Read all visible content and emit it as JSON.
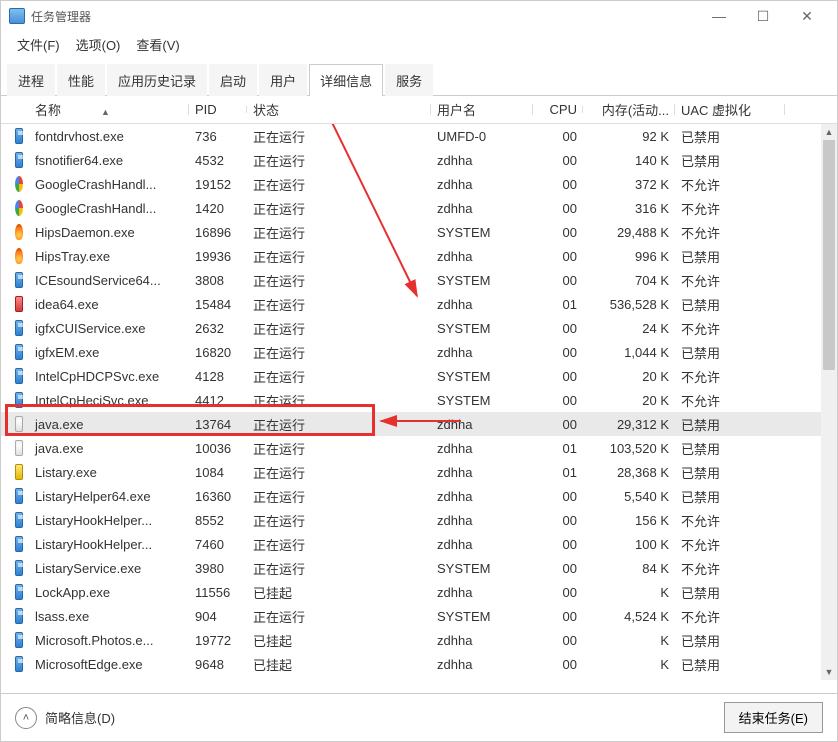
{
  "window": {
    "title": "任务管理器"
  },
  "menu": {
    "file": "文件(F)",
    "options": "选项(O)",
    "view": "查看(V)"
  },
  "tabs": {
    "processes": "进程",
    "performance": "性能",
    "app_history": "应用历史记录",
    "startup": "启动",
    "users": "用户",
    "details": "详细信息",
    "services": "服务"
  },
  "columns": {
    "name": "名称",
    "pid": "PID",
    "state": "状态",
    "user": "用户名",
    "cpu": "CPU",
    "mem": "内存(活动...",
    "uac": "UAC 虚拟化"
  },
  "rows": [
    {
      "icon": "generic",
      "name": "fontdrvhost.exe",
      "pid": "736",
      "state": "正在运行",
      "user": "UMFD-0",
      "cpu": "00",
      "mem": "92 K",
      "uac": "已禁用"
    },
    {
      "icon": "generic",
      "name": "fsnotifier64.exe",
      "pid": "4532",
      "state": "正在运行",
      "user": "zdhha",
      "cpu": "00",
      "mem": "140 K",
      "uac": "已禁用"
    },
    {
      "icon": "google",
      "name": "GoogleCrashHandl...",
      "pid": "19152",
      "state": "正在运行",
      "user": "zdhha",
      "cpu": "00",
      "mem": "372 K",
      "uac": "不允许"
    },
    {
      "icon": "google",
      "name": "GoogleCrashHandl...",
      "pid": "1420",
      "state": "正在运行",
      "user": "zdhha",
      "cpu": "00",
      "mem": "316 K",
      "uac": "不允许"
    },
    {
      "icon": "fire",
      "name": "HipsDaemon.exe",
      "pid": "16896",
      "state": "正在运行",
      "user": "SYSTEM",
      "cpu": "00",
      "mem": "29,488 K",
      "uac": "不允许"
    },
    {
      "icon": "fire",
      "name": "HipsTray.exe",
      "pid": "19936",
      "state": "正在运行",
      "user": "zdhha",
      "cpu": "00",
      "mem": "996 K",
      "uac": "已禁用"
    },
    {
      "icon": "generic",
      "name": "ICEsoundService64...",
      "pid": "3808",
      "state": "正在运行",
      "user": "SYSTEM",
      "cpu": "00",
      "mem": "704 K",
      "uac": "不允许"
    },
    {
      "icon": "red",
      "name": "idea64.exe",
      "pid": "15484",
      "state": "正在运行",
      "user": "zdhha",
      "cpu": "01",
      "mem": "536,528 K",
      "uac": "已禁用"
    },
    {
      "icon": "generic",
      "name": "igfxCUIService.exe",
      "pid": "2632",
      "state": "正在运行",
      "user": "SYSTEM",
      "cpu": "00",
      "mem": "24 K",
      "uac": "不允许"
    },
    {
      "icon": "generic",
      "name": "igfxEM.exe",
      "pid": "16820",
      "state": "正在运行",
      "user": "zdhha",
      "cpu": "00",
      "mem": "1,044 K",
      "uac": "已禁用"
    },
    {
      "icon": "generic",
      "name": "IntelCpHDCPSvc.exe",
      "pid": "4128",
      "state": "正在运行",
      "user": "SYSTEM",
      "cpu": "00",
      "mem": "20 K",
      "uac": "不允许"
    },
    {
      "icon": "generic",
      "name": "IntelCpHeciSvc.exe",
      "pid": "4412",
      "state": "正在运行",
      "user": "SYSTEM",
      "cpu": "00",
      "mem": "20 K",
      "uac": "不允许"
    },
    {
      "icon": "java",
      "name": "java.exe",
      "pid": "13764",
      "state": "正在运行",
      "user": "zdhha",
      "cpu": "00",
      "mem": "29,312 K",
      "uac": "已禁用",
      "highlight": true
    },
    {
      "icon": "java",
      "name": "java.exe",
      "pid": "10036",
      "state": "正在运行",
      "user": "zdhha",
      "cpu": "01",
      "mem": "103,520 K",
      "uac": "已禁用"
    },
    {
      "icon": "yellow",
      "name": "Listary.exe",
      "pid": "1084",
      "state": "正在运行",
      "user": "zdhha",
      "cpu": "01",
      "mem": "28,368 K",
      "uac": "已禁用"
    },
    {
      "icon": "generic",
      "name": "ListaryHelper64.exe",
      "pid": "16360",
      "state": "正在运行",
      "user": "zdhha",
      "cpu": "00",
      "mem": "5,540 K",
      "uac": "已禁用"
    },
    {
      "icon": "generic",
      "name": "ListaryHookHelper...",
      "pid": "8552",
      "state": "正在运行",
      "user": "zdhha",
      "cpu": "00",
      "mem": "156 K",
      "uac": "不允许"
    },
    {
      "icon": "generic",
      "name": "ListaryHookHelper...",
      "pid": "7460",
      "state": "正在运行",
      "user": "zdhha",
      "cpu": "00",
      "mem": "100 K",
      "uac": "不允许"
    },
    {
      "icon": "generic",
      "name": "ListaryService.exe",
      "pid": "3980",
      "state": "正在运行",
      "user": "SYSTEM",
      "cpu": "00",
      "mem": "84 K",
      "uac": "不允许"
    },
    {
      "icon": "generic",
      "name": "LockApp.exe",
      "pid": "11556",
      "state": "已挂起",
      "user": "zdhha",
      "cpu": "00",
      "mem": "K",
      "uac": "已禁用"
    },
    {
      "icon": "generic",
      "name": "lsass.exe",
      "pid": "904",
      "state": "正在运行",
      "user": "SYSTEM",
      "cpu": "00",
      "mem": "4,524 K",
      "uac": "不允许"
    },
    {
      "icon": "generic",
      "name": "Microsoft.Photos.e...",
      "pid": "19772",
      "state": "已挂起",
      "user": "zdhha",
      "cpu": "00",
      "mem": "K",
      "uac": "已禁用"
    },
    {
      "icon": "generic",
      "name": "MicrosoftEdge.exe",
      "pid": "9648",
      "state": "已挂起",
      "user": "zdhha",
      "cpu": "00",
      "mem": "K",
      "uac": "已禁用"
    }
  ],
  "footer": {
    "fewer": "简略信息(D)",
    "end_task": "结束任务(E)"
  }
}
